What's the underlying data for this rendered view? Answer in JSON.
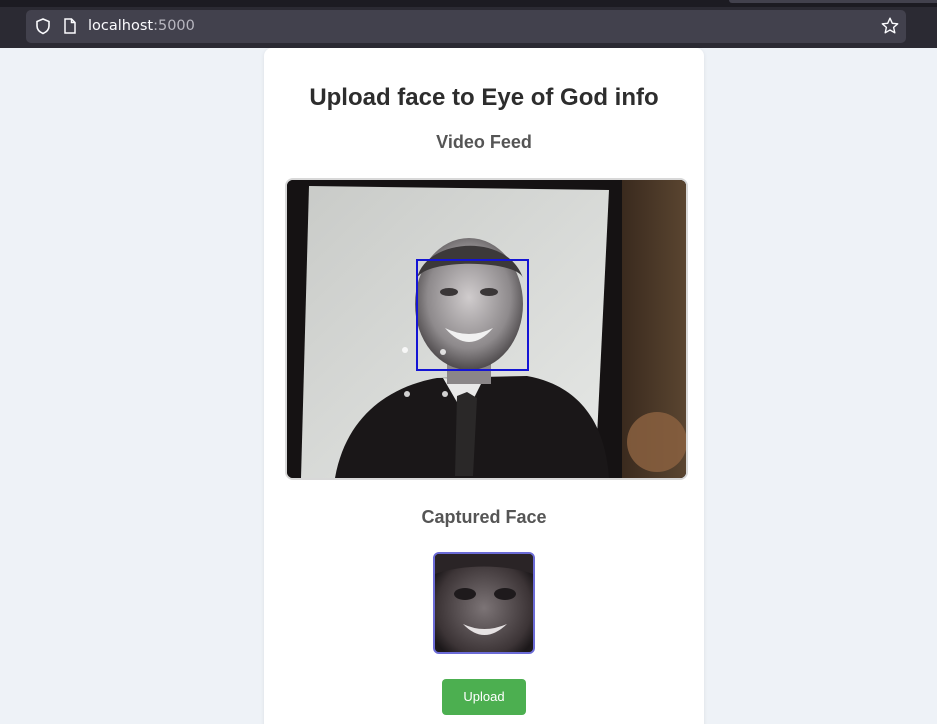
{
  "browser": {
    "url_host": "localhost",
    "url_port": ":5000",
    "icons": [
      "shield-icon",
      "page-icon",
      "bookmark-star-icon"
    ]
  },
  "page": {
    "title": "Upload face to Eye of God info",
    "video_heading": "Video Feed",
    "captured_heading": "Captured Face",
    "upload_label": "Upload"
  },
  "colors": {
    "button": "#4caf50",
    "face_box": "#1414d4",
    "background": "#eef2f7"
  }
}
